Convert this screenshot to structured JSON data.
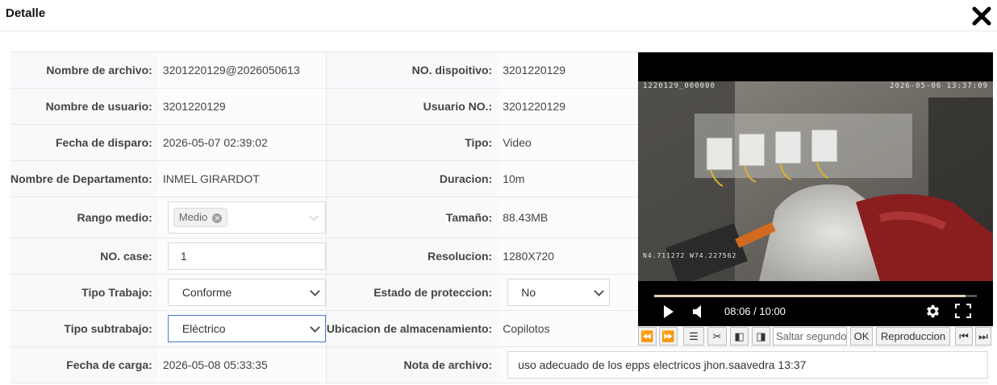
{
  "dialog": {
    "title": "Detalle",
    "close_icon": "close-icon"
  },
  "fields": {
    "filename": {
      "label": "Nombre de archivo:",
      "value": "3201220129@2026050613"
    },
    "device_no": {
      "label": "NO. dispoitivo:",
      "value": "3201220129"
    },
    "username": {
      "label": "Nombre de usuario:",
      "value": "3201220129"
    },
    "user_no": {
      "label": "Usuario NO.:",
      "value": "3201220129"
    },
    "trigger_date": {
      "label": "Fecha de disparo:",
      "value": "2026-05-07 02:39:02"
    },
    "type": {
      "label": "Tipo:",
      "value": "Video"
    },
    "department": {
      "label": "Nombre de Departamento:",
      "value": "INMEL GIRARDOT"
    },
    "duration": {
      "label": "Duracion:",
      "value": "10m"
    },
    "range": {
      "label": "Rango medio:",
      "tag": "Medio"
    },
    "size": {
      "label": "Tamaño:",
      "value": "88.43MB"
    },
    "case_no": {
      "label": "NO. case:",
      "value": "1"
    },
    "resolution": {
      "label": "Resolucion:",
      "value": "1280X720"
    },
    "work_type": {
      "label": "Tipo Trabajo:",
      "value": "Conforme"
    },
    "protection": {
      "label": "Estado de proteccion:",
      "value": "No"
    },
    "subwork_type": {
      "label": "Tipo subtrabajo:",
      "value": "Eléctrico"
    },
    "storage": {
      "label": "Ubicacion de almacenamiento:",
      "value": "Copilotos"
    },
    "upload_date": {
      "label": "Fecha de carga:",
      "value": "2026-05-08 05:33:35"
    },
    "file_note": {
      "label": "Nota de archivo:",
      "value": "uso adecuado de los epps electricos jhon.saavedra 13:37"
    }
  },
  "video": {
    "osd_left": "1220129_000000",
    "osd_right": "2026-05-06 13:37:09",
    "osd_gps": "N4.711272 W74.227562",
    "time": "08:06 / 10:00",
    "progress": 0.965
  },
  "toolbar": {
    "skip_placeholder": "Saltar segundo",
    "ok_label": "OK",
    "playback_label": "Reproduccion"
  }
}
